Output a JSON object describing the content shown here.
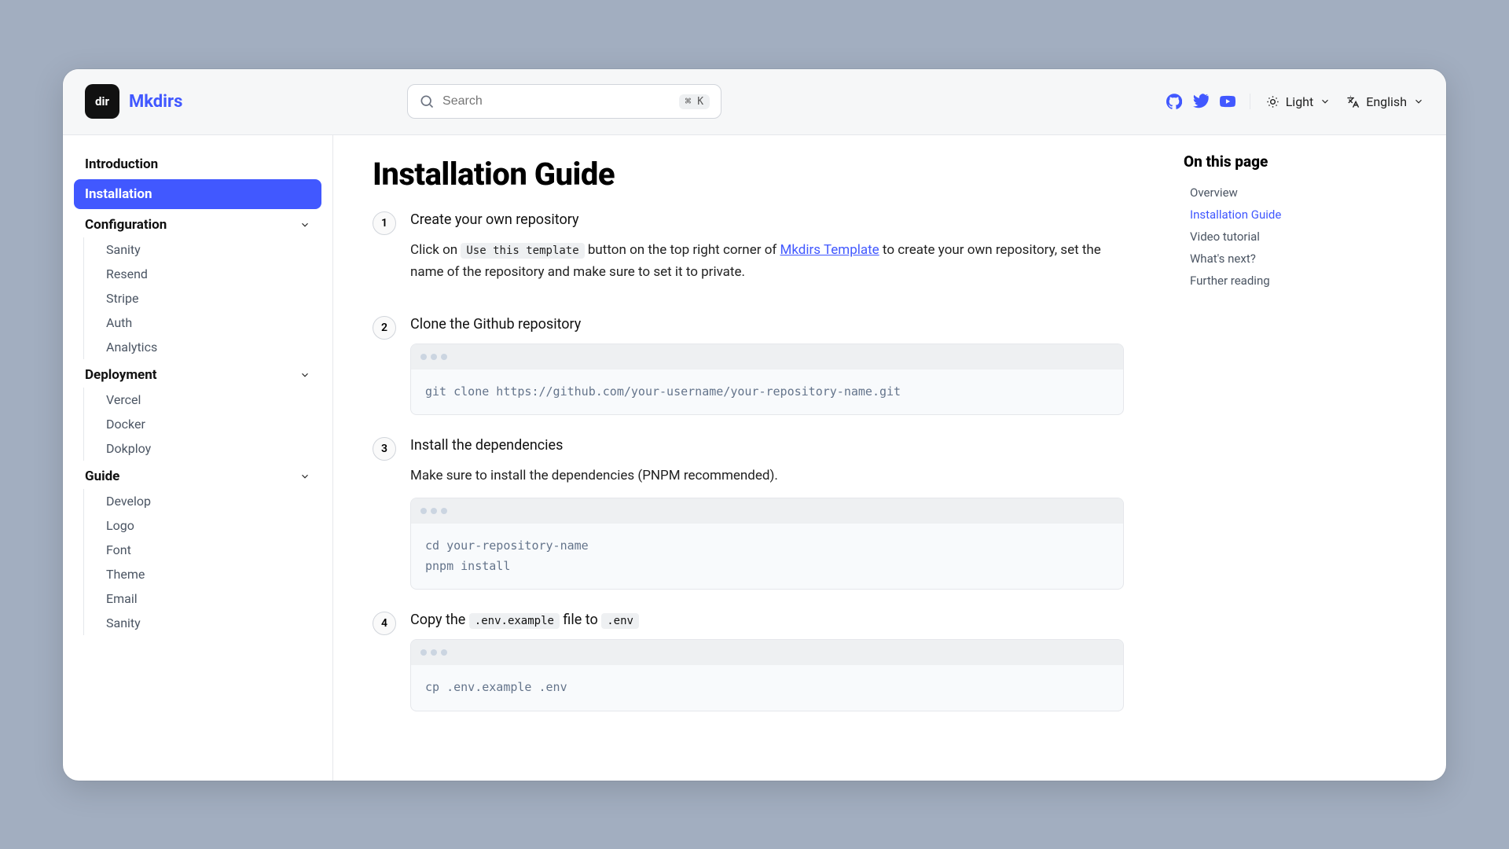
{
  "brand": "Mkdirs",
  "logo_text": "dir",
  "search": {
    "placeholder": "Search",
    "kbd": "⌘ K"
  },
  "theme": {
    "label": "Light"
  },
  "language": {
    "label": "English"
  },
  "sidebar": {
    "items": [
      {
        "label": "Introduction",
        "key": "introduction"
      },
      {
        "label": "Installation",
        "key": "installation",
        "active": true
      }
    ],
    "sections": [
      {
        "label": "Configuration",
        "items": [
          "Sanity",
          "Resend",
          "Stripe",
          "Auth",
          "Analytics"
        ]
      },
      {
        "label": "Deployment",
        "items": [
          "Vercel",
          "Docker",
          "Dokploy"
        ]
      },
      {
        "label": "Guide",
        "items": [
          "Develop",
          "Logo",
          "Font",
          "Theme",
          "Email",
          "Sanity"
        ]
      }
    ]
  },
  "page": {
    "title": "Installation Guide",
    "steps": [
      {
        "num": "1",
        "title": "Create your own repository",
        "pre": "Click on ",
        "code": "Use this template",
        "mid": " button on the top right corner of ",
        "link": "Mkdirs Template",
        "post": " to create your own repository, set the name of the repository and make sure to set it to private."
      },
      {
        "num": "2",
        "title": "Clone the Github repository",
        "codeblock": "git clone https://github.com/your-username/your-repository-name.git"
      },
      {
        "num": "3",
        "title": "Install the dependencies",
        "text": "Make sure to install the dependencies (PNPM recommended).",
        "codeblock": "cd your-repository-name\npnpm install"
      },
      {
        "num": "4",
        "title_pre": "Copy the ",
        "title_code1": ".env.example",
        "title_mid": " file to ",
        "title_code2": ".env",
        "codeblock": "cp .env.example .env"
      }
    ]
  },
  "toc": {
    "heading": "On this page",
    "items": [
      {
        "label": "Overview"
      },
      {
        "label": "Installation Guide",
        "active": true
      },
      {
        "label": "Video tutorial"
      },
      {
        "label": "What's next?"
      },
      {
        "label": "Further reading"
      }
    ]
  }
}
